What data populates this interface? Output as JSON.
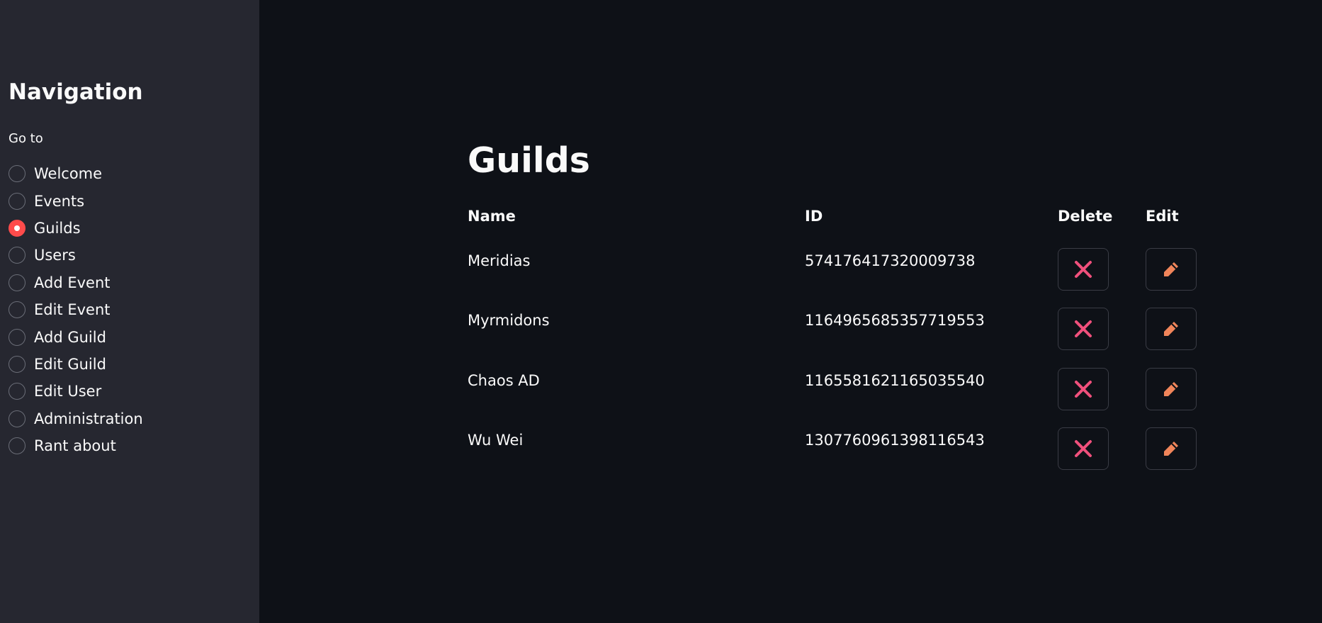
{
  "sidebar": {
    "title": "Navigation",
    "radio_label": "Go to",
    "options": [
      "Welcome",
      "Events",
      "Guilds",
      "Users",
      "Add Event",
      "Edit Event",
      "Add Guild",
      "Edit Guild",
      "Edit User",
      "Administration",
      "Rant about"
    ],
    "selected": "Guilds",
    "accent_color": "#ff4b4b"
  },
  "main": {
    "title": "Guilds",
    "columns": {
      "name": "Name",
      "id": "ID",
      "delete": "Delete",
      "edit": "Edit"
    },
    "rows": [
      {
        "name": "Meridias",
        "id": "574176417320009738"
      },
      {
        "name": "Myrmidons",
        "id": "1164965685357719553"
      },
      {
        "name": "Chaos AD",
        "id": "1165581621165035540"
      },
      {
        "name": "Wu Wei",
        "id": "1307760961398116543"
      }
    ],
    "icons": {
      "delete": "cross-mark-icon",
      "edit": "pencil-icon"
    },
    "colors": {
      "background": "#0e1117",
      "sidebar": "#262730",
      "delete_icon": "#f0507c",
      "edit_icon": "#f0855a"
    }
  }
}
